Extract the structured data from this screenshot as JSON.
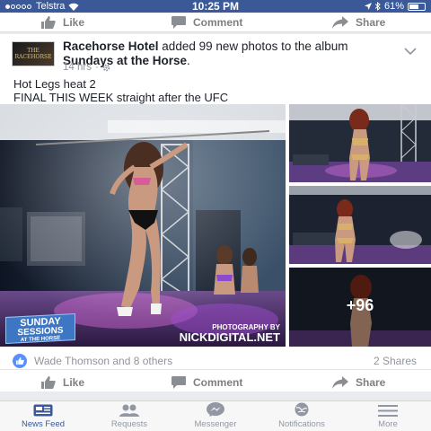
{
  "status_bar": {
    "carrier": "Telstra",
    "time": "10:25 PM",
    "battery": "61%",
    "battery_level": 0.61
  },
  "previous_post_actions": {
    "like": "Like",
    "comment": "Comment",
    "share": "Share"
  },
  "post": {
    "author": "Racehorse Hotel",
    "action": " added 99 new photos to the album ",
    "album": "Sundays at the Horse",
    "album_suffix": ".",
    "time": "14 hrs",
    "privacy_icon": "gear-icon",
    "avatar_text": "THE RACEHORSE",
    "text_line1": "Hot Legs heat 2",
    "text_line2": "FINAL THIS WEEK straight after the UFC",
    "photos": {
      "watermark_left_1": "SUNDAY",
      "watermark_left_2": "SESSIONS",
      "watermark_left_3": "AT THE HORSE",
      "watermark_right_1": "PHOTOGRAPHY BY",
      "watermark_right_2": "NICKDIGITAL.NET",
      "more_count": "+96"
    },
    "reactions": {
      "names": "Wade Thomson and 8 others",
      "shares": "2 Shares"
    },
    "actions": {
      "like": "Like",
      "comment": "Comment",
      "share": "Share"
    }
  },
  "tabs": [
    {
      "label": "News Feed",
      "icon": "news-feed-icon"
    },
    {
      "label": "Requests",
      "icon": "requests-icon"
    },
    {
      "label": "Messenger",
      "icon": "messenger-icon"
    },
    {
      "label": "Notifications",
      "icon": "notifications-icon"
    },
    {
      "label": "More",
      "icon": "more-icon"
    }
  ],
  "colors": {
    "brand": "#3b5998",
    "like_blue": "#5890ff"
  }
}
